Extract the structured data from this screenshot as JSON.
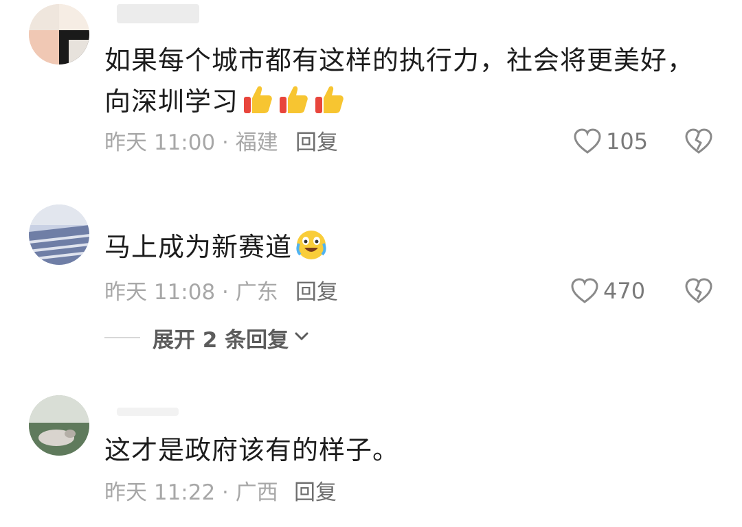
{
  "comments": [
    {
      "text": "如果每个城市都有这样的执行力，社会将更美好，向深圳学习",
      "emojis": [
        "thumbs-up-icon",
        "thumbs-up-icon",
        "thumbs-up-icon"
      ],
      "meta": "昨天 11:00 · 福建",
      "reply_label": "回复",
      "likes": "105"
    },
    {
      "text": "马上成为新赛道",
      "emojis": [
        "crying-laughing-icon"
      ],
      "meta": "昨天 11:08 · 广东",
      "reply_label": "回复",
      "likes": "470",
      "expand_label": "展开 2 条回复"
    },
    {
      "text": "这才是政府该有的样子。",
      "meta": "昨天 11:22 · 广西",
      "reply_label": "回复"
    }
  ],
  "colors": {
    "text": "#1c1c1c",
    "meta": "#a7a7a7",
    "icon": "#8a8a8a"
  }
}
